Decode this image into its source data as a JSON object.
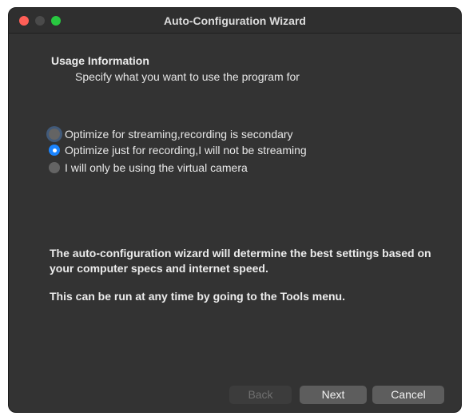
{
  "window": {
    "title": "Auto-Configuration Wizard"
  },
  "usage": {
    "heading": "Usage Information",
    "subheading": "Specify what you want to use the program for"
  },
  "options": [
    {
      "label": "Optimize for streaming,recording is secondary",
      "selected": false
    },
    {
      "label": "Optimize just for recording,I will not be streaming",
      "selected": true
    },
    {
      "label": "I will only be using the virtual camera",
      "selected": false
    }
  ],
  "info": {
    "line1": "The auto-configuration wizard will determine the best settings based on your computer specs and internet speed.",
    "line2": "This can be run at any time by going to the Tools menu."
  },
  "buttons": {
    "back": "Back",
    "next": "Next",
    "cancel": "Cancel"
  },
  "colors": {
    "accent": "#1a84ff",
    "close": "#ff5f57",
    "maximize": "#28c840"
  }
}
